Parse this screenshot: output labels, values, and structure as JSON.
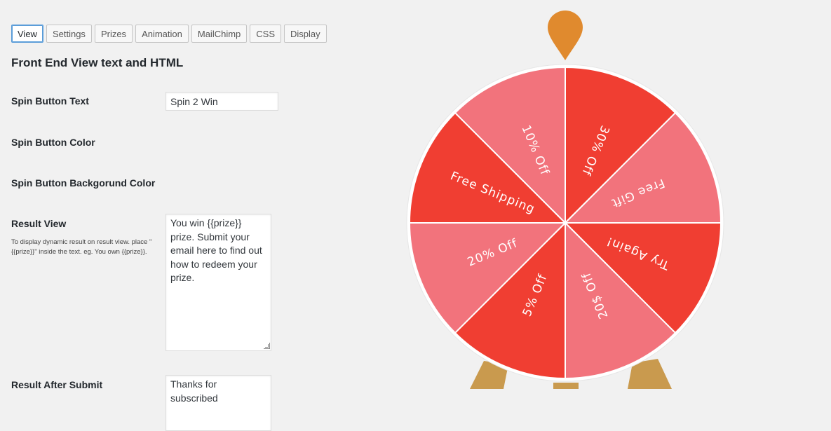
{
  "tabs": [
    {
      "label": "View",
      "active": true
    },
    {
      "label": "Settings",
      "active": false
    },
    {
      "label": "Prizes",
      "active": false
    },
    {
      "label": "Animation",
      "active": false
    },
    {
      "label": "MailChimp",
      "active": false
    },
    {
      "label": "CSS",
      "active": false
    },
    {
      "label": "Display",
      "active": false
    }
  ],
  "section_title": "Front End View text and HTML",
  "fields": {
    "spin_button_text": {
      "label": "Spin Button Text",
      "value": "Spin 2 Win"
    },
    "spin_button_color": {
      "label": "Spin Button Color"
    },
    "spin_button_bg_color": {
      "label": "Spin Button Backgorund Color"
    },
    "result_view": {
      "label": "Result View",
      "hint": "To display dynamic result on result view. place \"{{prize}}\" inside the text. eg. You own {{prize}}.",
      "value": "You win {{prize}} prize. Submit your email here to find out how to redeem your prize."
    },
    "result_after_submit": {
      "label": "Result After Submit",
      "value": "Thanks for subscribed"
    }
  },
  "wheel": {
    "slices": [
      {
        "label": "Try Again!",
        "color": "#f03e32"
      },
      {
        "label": "20$ Off",
        "color": "#f2737c"
      },
      {
        "label": "5% Off",
        "color": "#f03e32"
      },
      {
        "label": "20% Off",
        "color": "#f2737c"
      },
      {
        "label": "Free Shipping",
        "color": "#f03e32"
      },
      {
        "label": "10% Off",
        "color": "#f2737c"
      },
      {
        "label": "30% Off",
        "color": "#f03e32"
      },
      {
        "label": "Free Gift",
        "color": "#f2737c"
      }
    ],
    "pointer_color": "#e08a2e",
    "stand_color": "#c99a4e",
    "rim_color": "#ffffff"
  }
}
